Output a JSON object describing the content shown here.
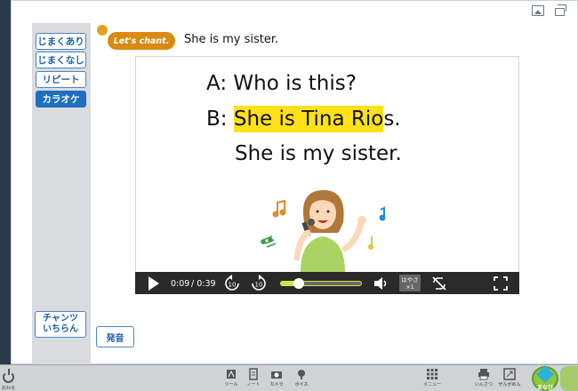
{
  "side_buttons": [
    {
      "label": "じまくあり",
      "active": false
    },
    {
      "label": "じまくなし",
      "active": false
    },
    {
      "label": "リピート",
      "active": false
    },
    {
      "label": "カラオケ",
      "active": true
    }
  ],
  "chant_list": {
    "line1": "チャンツ",
    "line2": "いちらん"
  },
  "speak_button": "発音",
  "header": {
    "badge": "Let's chant.",
    "title": "She is my sister."
  },
  "lyrics": {
    "line1": "A: Who is this?",
    "line2_prefix": "B: ",
    "line2_highlight": "She is Tina Rio",
    "line2_rest": "s.",
    "line3": "She is my sister."
  },
  "player": {
    "current_time": "0:09",
    "total_time": "/ 0:39",
    "rewind_label": "10",
    "forward_label": "10",
    "speed_line1": "はやさ",
    "speed_line2": "×1",
    "progress": 0.23
  },
  "taskbar": {
    "power_label": "おわる",
    "items": [
      "ツール",
      "ノート",
      "カメラ",
      "ボイス",
      "メニュー",
      "いんさつ",
      "ぜんがめん"
    ]
  },
  "manabi": {
    "label": "まなび"
  },
  "colors": {
    "accent": "#1f6fc0",
    "highlight": "#ffe11a",
    "badge": "#d98a12",
    "progress": "#d4e04a"
  }
}
